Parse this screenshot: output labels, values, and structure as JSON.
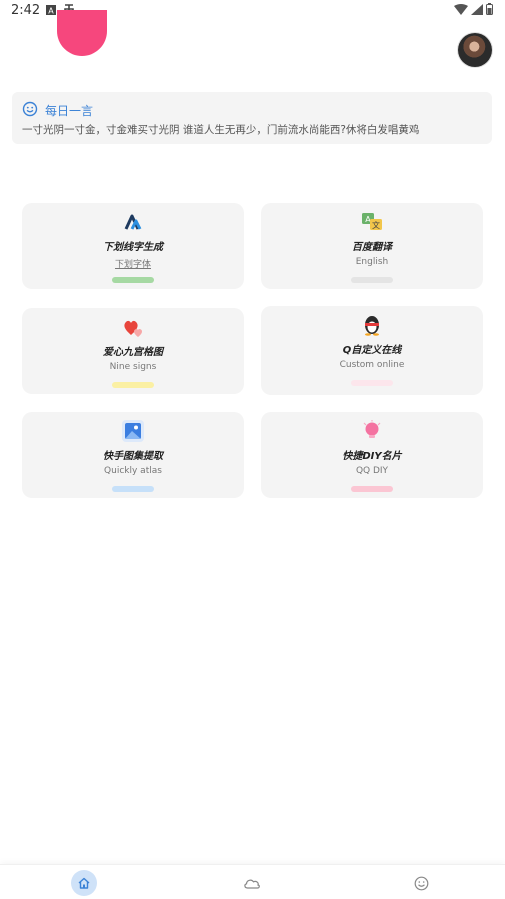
{
  "status_bar": {
    "time": "2:42"
  },
  "header": {
    "accent_color": "#f6477d"
  },
  "quote": {
    "title": "每日一言",
    "text": "一寸光阴一寸金，寸金难买寸光阴  谁道人生无再少，门前流水尚能西?休将白发唱黄鸡",
    "accent_color": "#3b82d6"
  },
  "tiles": [
    {
      "title": "下划线字生成",
      "subtitle": "下划字体",
      "icon": "blue-mountain-logo-icon",
      "bar_color": "#a6d9a3"
    },
    {
      "title": "百度翻译",
      "subtitle": "English",
      "icon": "translate-icon",
      "bar_color": "#e4e4e4"
    },
    {
      "title": "爱心九宫格图",
      "subtitle": "Nine signs",
      "icon": "hearts-icon",
      "bar_color": "#fbf0a3"
    },
    {
      "title": "Q自定义在线",
      "subtitle": "Custom online",
      "icon": "qq-penguin-icon",
      "bar_color": "#fce6ec"
    },
    {
      "title": "快手图集提取",
      "subtitle": "Quickly atlas",
      "icon": "image-icon",
      "bar_color": "#c6e0f9"
    },
    {
      "title": "快捷DIY名片",
      "subtitle": "QQ DIY",
      "icon": "lightbulb-icon",
      "bar_color": "#fbc6d3"
    }
  ],
  "nav": {
    "items": [
      "home-icon",
      "cloud-icon",
      "smiley-icon"
    ],
    "active_color": "#cfe2f8"
  }
}
